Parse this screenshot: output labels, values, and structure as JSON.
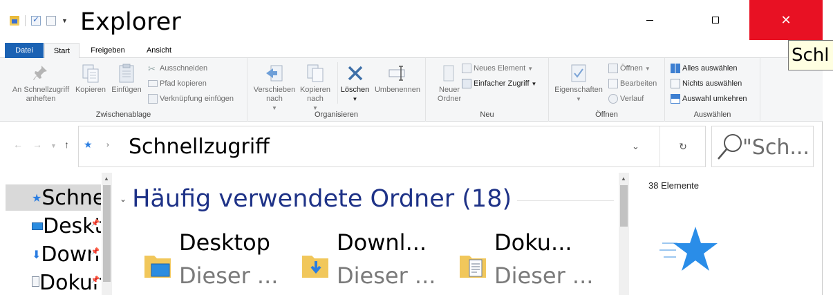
{
  "window": {
    "title": "Explorer",
    "close_label": "✕",
    "tooltip": "Schl"
  },
  "tabs": [
    "Datei",
    "Start",
    "Freigeben",
    "Ansicht"
  ],
  "ribbon": {
    "clipboard": {
      "pin_label": "An Schnellzugriff anheften",
      "copy_label": "Kopieren",
      "paste_label": "Einfügen",
      "cut_label": "Ausschneiden",
      "copy_path_label": "Pfad kopieren",
      "paste_shortcut_label": "Verknüpfung einfügen",
      "group_label": "Zwischenablage"
    },
    "organize": {
      "move_label": "Verschieben nach",
      "copy_to_label": "Kopieren nach",
      "delete_label": "Löschen",
      "rename_label": "Umbenennen",
      "group_label": "Organisieren"
    },
    "new": {
      "new_folder_label": "Neuer Ordner",
      "new_item_label": "Neues Element",
      "easy_access_label": "Einfacher Zugriff",
      "group_label": "Neu"
    },
    "open": {
      "properties_label": "Eigenschaften",
      "open_label": "Öffnen",
      "edit_label": "Bearbeiten",
      "history_label": "Verlauf",
      "group_label": "Öffnen"
    },
    "select": {
      "select_all_label": "Alles auswählen",
      "select_none_label": "Nichts auswählen",
      "invert_label": "Auswahl umkehren",
      "group_label": "Auswählen"
    }
  },
  "address": {
    "path": "Schnellzugriff",
    "refresh": "↻"
  },
  "search": {
    "placeholder": "\"Sch..."
  },
  "nav_pane": {
    "items": [
      {
        "label": "Schnellzugriff",
        "icon": "star-icon"
      },
      {
        "label": "Desktop",
        "icon": "desktop-icon"
      },
      {
        "label": "Downloads",
        "icon": "download-icon"
      },
      {
        "label": "Dokumente",
        "icon": "document-icon"
      }
    ]
  },
  "content": {
    "section_title": "Häufig verwendete Ordner (18)",
    "tiles": [
      {
        "name": "Desktop",
        "sub": "Dieser ..."
      },
      {
        "name": "Downl...",
        "sub": "Dieser ..."
      },
      {
        "name": "Doku...",
        "sub": "Dieser ..."
      }
    ]
  },
  "details": {
    "count": "38 Elemente"
  },
  "colors": {
    "accent": "#1b62b3",
    "close": "#e81123",
    "section_title": "#1e3287",
    "star": "#2a7de1"
  }
}
